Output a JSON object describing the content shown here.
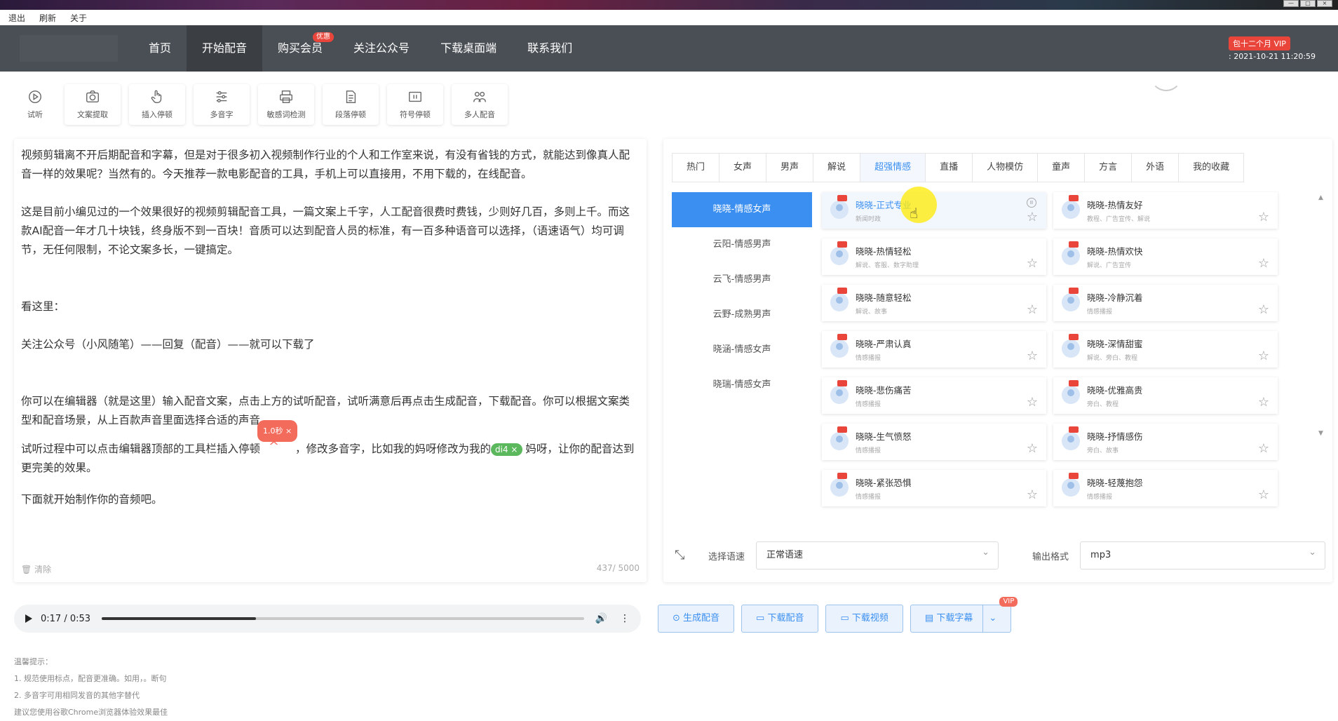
{
  "window": {
    "minimize": "—",
    "maximize": "□",
    "close": "×"
  },
  "menubar": [
    "退出",
    "刷新",
    "关于"
  ],
  "nav": {
    "items": [
      {
        "label": "首页",
        "active": false
      },
      {
        "label": "开始配音",
        "active": true
      },
      {
        "label": "购买会员",
        "active": false,
        "badge": "优惠"
      },
      {
        "label": "关注公众号",
        "active": false
      },
      {
        "label": "下载桌面端",
        "active": false
      },
      {
        "label": "联系我们",
        "active": false
      }
    ],
    "vip_label": "包十二个月 VIP",
    "vip_expire": ": 2021-10-21 11:20:59"
  },
  "toolbar": [
    {
      "label": "试听",
      "icon": "play-circle-icon"
    },
    {
      "label": "文案提取",
      "icon": "camera-icon"
    },
    {
      "label": "插入停顿",
      "icon": "hand-pointer-icon"
    },
    {
      "label": "多音字",
      "icon": "sliders-icon"
    },
    {
      "label": "敏感词检测",
      "icon": "printer-icon"
    },
    {
      "label": "段落停顿",
      "icon": "document-icon"
    },
    {
      "label": "符号停顿",
      "icon": "symbol-box-icon"
    },
    {
      "label": "多人配音",
      "icon": "users-icon"
    }
  ],
  "editor": {
    "p1": "视频剪辑离不开后期配音和字幕，但是对于很多初入视频制作行业的个人和工作室来说，有没有省钱的方式，就能达到像真人配音一样的效果呢？当然有的。今天推荐一款电影配音的工具，手机上可以直接用，不用下载的，在线配音。",
    "p2": "这是目前小编见过的一个效果很好的视频剪辑配音工具，一篇文案上千字，人工配音很费时费钱，少则好几百，多则上千。而这款AI配音一年才几十块钱，终身版不到一百块！音质可以达到配音人员的标准，有一百多种语音可以选择，（语速语气）均可调节，无任何限制，不论文案多长，一键搞定。",
    "p3": "看这里：",
    "p4": "关注公众号（小风随笔）——回复（配音）——就可以下载了",
    "p5": "你可以在编辑器（就是这里）输入配音文案，点击上方的试听配音，试听满意后再点击生成配音，下载配音。你可以根据文案类型和配音场景，从上百款声音里面选择合适的声音。",
    "p6a": "试听过程中可以点击编辑器顶部的工具栏插入停顿",
    "pause_tag": "1.0秒 ×",
    "p6b": "，修改多音字，比如我的妈呀修改为我的",
    "poly_tag": "di4 ×",
    "p6c": " 妈呀，让你的配音达到更完美的效果。",
    "p7": "下面就开始制作你的音频吧。",
    "clear": "清除",
    "count": "437/ 5000"
  },
  "tabs": [
    {
      "label": "热门",
      "active": false
    },
    {
      "label": "女声",
      "active": false
    },
    {
      "label": "男声",
      "active": false
    },
    {
      "label": "解说",
      "active": false
    },
    {
      "label": "超强情感",
      "active": true
    },
    {
      "label": "直播",
      "active": false
    },
    {
      "label": "人物模仿",
      "active": false
    },
    {
      "label": "童声",
      "active": false
    },
    {
      "label": "方言",
      "active": false
    },
    {
      "label": "外语",
      "active": false
    },
    {
      "label": "我的收藏",
      "active": false
    }
  ],
  "categories": [
    {
      "label": "晓晓-情感女声",
      "active": true
    },
    {
      "label": "云阳-情感男声",
      "active": false
    },
    {
      "label": "云飞-情感男声",
      "active": false
    },
    {
      "label": "云野-成熟男声",
      "active": false
    },
    {
      "label": "晓涵-情感女声",
      "active": false
    },
    {
      "label": "晓瑞-情感女声",
      "active": false
    }
  ],
  "voices": [
    {
      "name": "晓晓-正式专业",
      "tags": "新闻时政",
      "active": true
    },
    {
      "name": "晓晓-热情友好",
      "tags": "教程、广告宣传、解说",
      "active": false
    },
    {
      "name": "晓晓-热情轻松",
      "tags": "解说、客服、数字助理",
      "active": false
    },
    {
      "name": "晓晓-热情欢快",
      "tags": "解说、广告宣传",
      "active": false
    },
    {
      "name": "晓晓-随意轻松",
      "tags": "解说、故事",
      "active": false
    },
    {
      "name": "晓晓-冷静沉着",
      "tags": "情感播报",
      "active": false
    },
    {
      "name": "晓晓-严肃认真",
      "tags": "情感播报",
      "active": false
    },
    {
      "name": "晓晓-深情甜蜜",
      "tags": "解说、旁白、教程",
      "active": false
    },
    {
      "name": "晓晓-悲伤痛苦",
      "tags": "情感播报",
      "active": false
    },
    {
      "name": "晓晓-优雅高贵",
      "tags": "旁白、教程",
      "active": false
    },
    {
      "name": "晓晓-生气愤怒",
      "tags": "情感播报",
      "active": false
    },
    {
      "name": "晓晓-抒情感伤",
      "tags": "旁白、故事",
      "active": false
    },
    {
      "name": "晓晓-紧张恐惧",
      "tags": "情感播报",
      "active": false
    },
    {
      "name": "晓晓-轻蔑抱怨",
      "tags": "情感播报",
      "active": false
    }
  ],
  "settings": {
    "speed_label": "选择语速",
    "speed_value": "正常语速",
    "format_label": "输出格式",
    "format_value": "mp3"
  },
  "player": {
    "time": "0:17 / 0:53",
    "progress": 0.32
  },
  "actions": [
    {
      "label": "生成配音",
      "icon": "play-circle-icon"
    },
    {
      "label": "下载配音",
      "icon": "folder-icon"
    },
    {
      "label": "下载视频",
      "icon": "video-icon"
    },
    {
      "label": "下载字幕",
      "icon": "subtitle-icon",
      "badge": "VIP"
    }
  ],
  "tips": [
    "温馨提示：",
    "1. 规范使用标点，配音更准确。如用，。断句",
    "2. 多音字可用相同发音的其他字替代",
    "建议您使用谷歌Chrome浏览器体验效果最佳"
  ],
  "colors": {
    "accent": "#3b8ff0",
    "nav_bg": "#4a4f55",
    "badge": "#e9453a"
  }
}
